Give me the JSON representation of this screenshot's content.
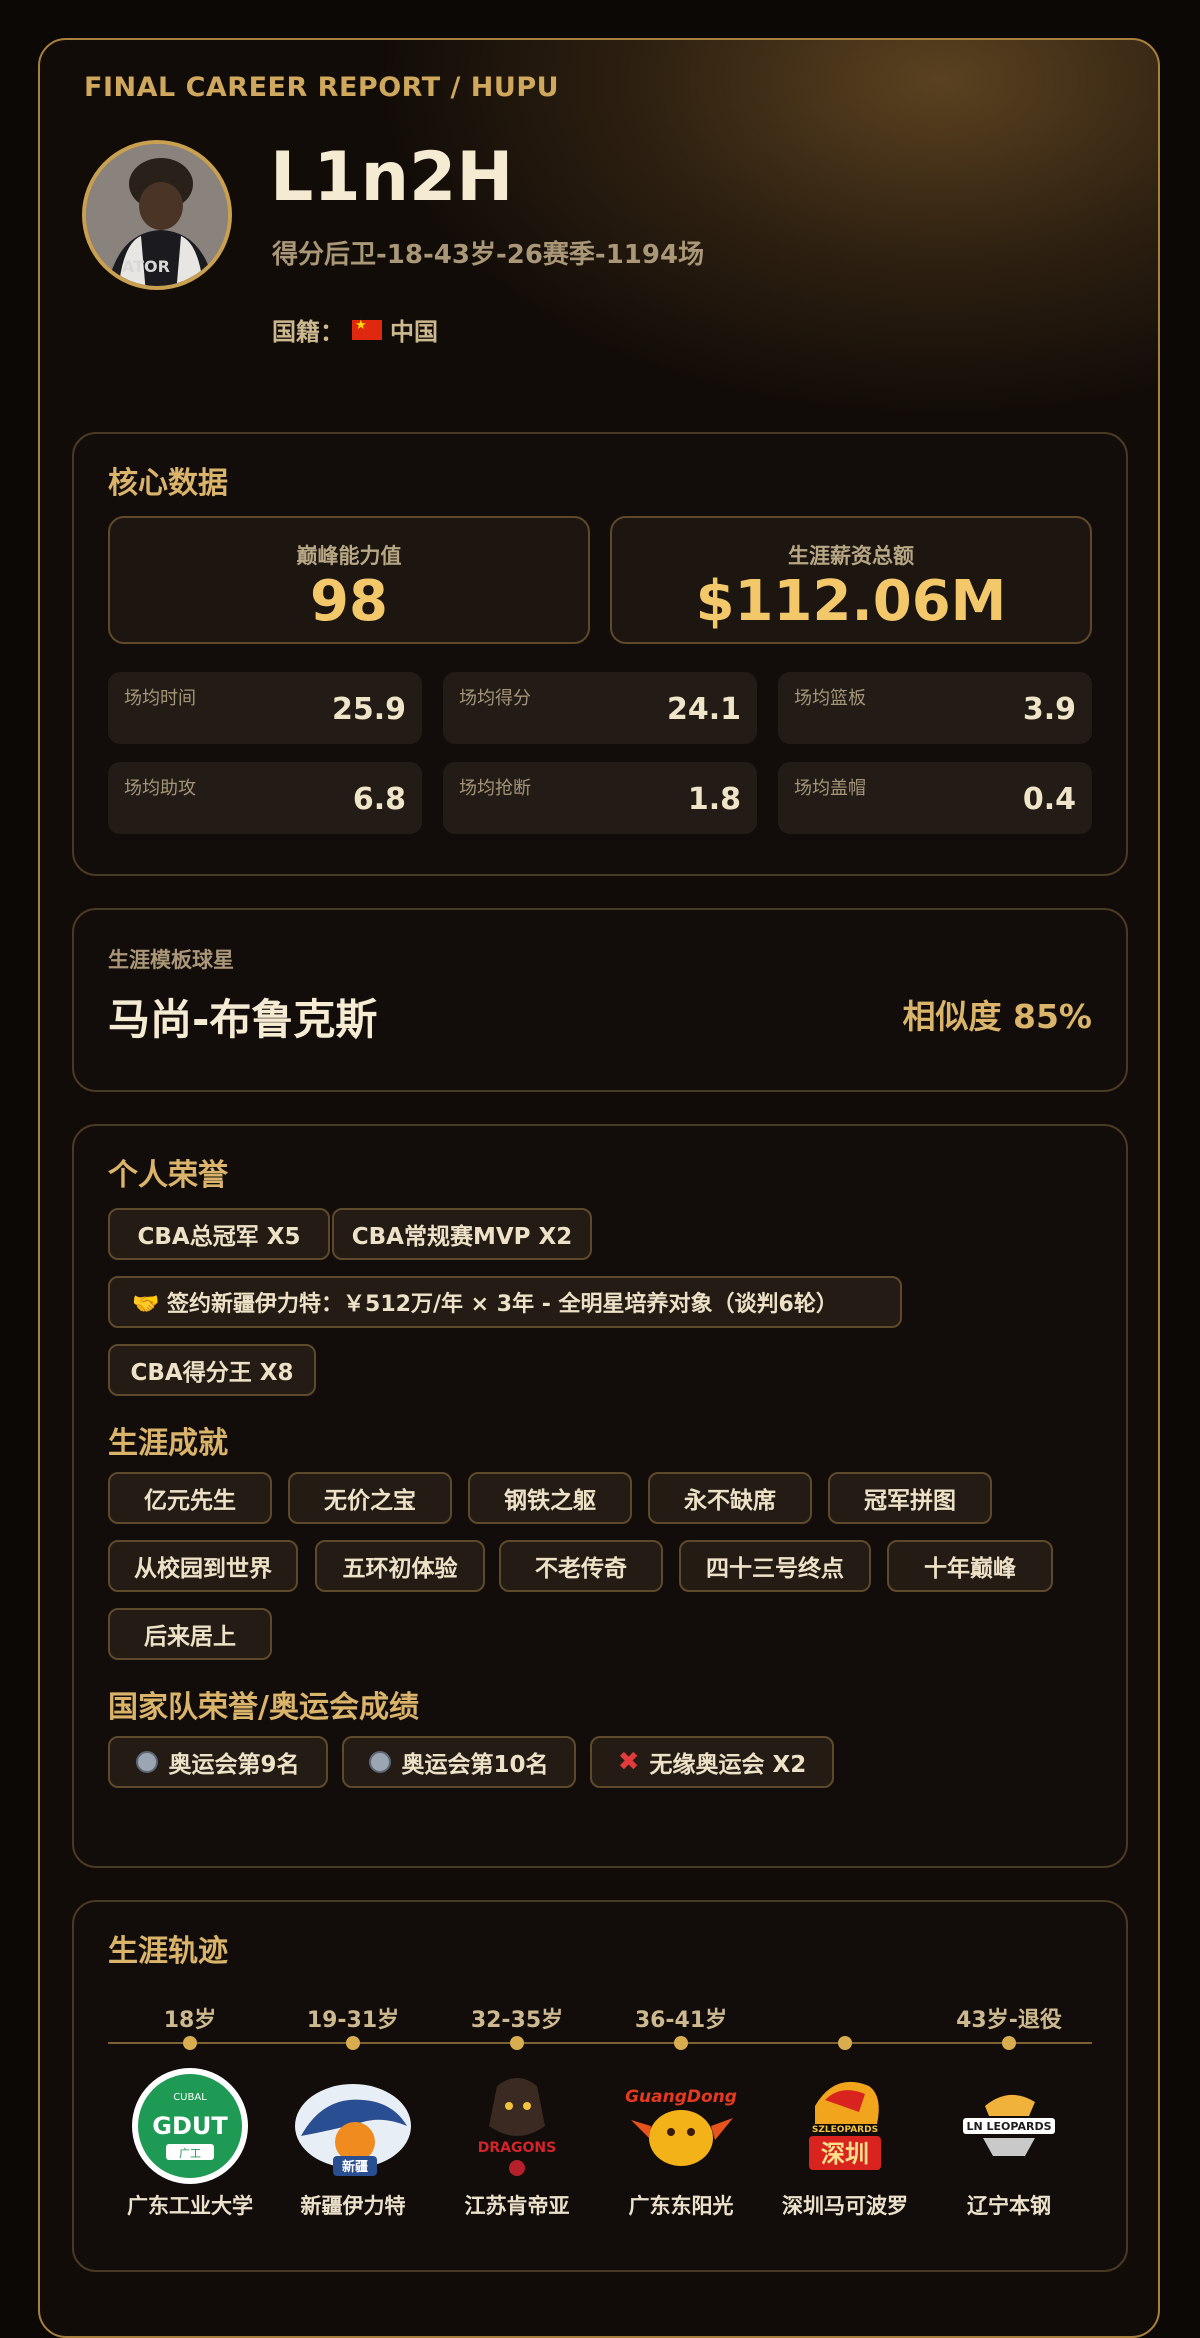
{
  "report_title": "FINAL CAREER REPORT / HUPU",
  "player": {
    "name": "L1n2H",
    "subtitle": "得分后卫-18-43岁-26赛季-1194场",
    "nationality_label": "国籍：",
    "nationality": "中国"
  },
  "core": {
    "title": "核心数据",
    "peak_label": "巅峰能力值",
    "peak_value": "98",
    "salary_label": "生涯薪资总额",
    "salary_value": "$112.06M",
    "stats": [
      {
        "label": "场均时间",
        "value": "25.9"
      },
      {
        "label": "场均得分",
        "value": "24.1"
      },
      {
        "label": "场均篮板",
        "value": "3.9"
      },
      {
        "label": "场均助攻",
        "value": "6.8"
      },
      {
        "label": "场均抢断",
        "value": "1.8"
      },
      {
        "label": "场均盖帽",
        "value": "0.4"
      }
    ]
  },
  "template": {
    "label": "生涯模板球星",
    "name": "马尚-布鲁克斯",
    "similarity": "相似度 85%"
  },
  "honors": {
    "title": "个人荣誉",
    "items": [
      "CBA总冠军 X5",
      "CBA常规赛MVP X2",
      "🤝 签约新疆伊力特：￥512万/年 × 3年 - 全明星培养对象（谈判6轮）",
      "CBA得分王 X8"
    ],
    "achievements_title": "生涯成就",
    "achievements": [
      "亿元先生",
      "无价之宝",
      "钢铁之躯",
      "永不缺席",
      "冠军拼图",
      "从校园到世界",
      "五环初体验",
      "不老传奇",
      "四十三号终点",
      "十年巅峰",
      "后来居上"
    ],
    "national_title": "国家队荣誉/奥运会成绩",
    "national": [
      {
        "icon": "medal-icon",
        "text": "奥运会第9名"
      },
      {
        "icon": "medal-icon",
        "text": "奥运会第10名"
      },
      {
        "icon": "cross-icon",
        "text": "无缘奥运会 X2"
      }
    ]
  },
  "career": {
    "title": "生涯轨迹",
    "stops": [
      {
        "age": "18岁",
        "team": "广东工业大学",
        "logo": "gdut-logo"
      },
      {
        "age": "19-31岁",
        "team": "新疆伊力特",
        "logo": "xinjiang-tigers-logo"
      },
      {
        "age": "32-35岁",
        "team": "江苏肯帝亚",
        "logo": "jiangsu-dragons-logo"
      },
      {
        "age": "36-41岁",
        "team": "广东东阳光",
        "logo": "guangdong-logo"
      },
      {
        "age": "",
        "team": "深圳马可波罗",
        "logo": "shenzhen-leopards-logo"
      },
      {
        "age": "43岁-退役",
        "team": "辽宁本钢",
        "logo": "liaoning-leopards-logo"
      }
    ],
    "logo_text": {
      "gdut_top": "CUBAL",
      "gdut_main": "GDUT",
      "gdut_bottom": "广工",
      "xinjiang": "新疆",
      "jiangsu": "DRAGONS",
      "guangdong": "GuangDong",
      "shenzhen_top": "SZLEOPARDS",
      "shenzhen": "深圳",
      "liaoning": "LN LEOPARDS"
    }
  },
  "colors": {
    "accent": "#d9b46a",
    "value": "#f2c86a",
    "border": "#a8803e"
  }
}
